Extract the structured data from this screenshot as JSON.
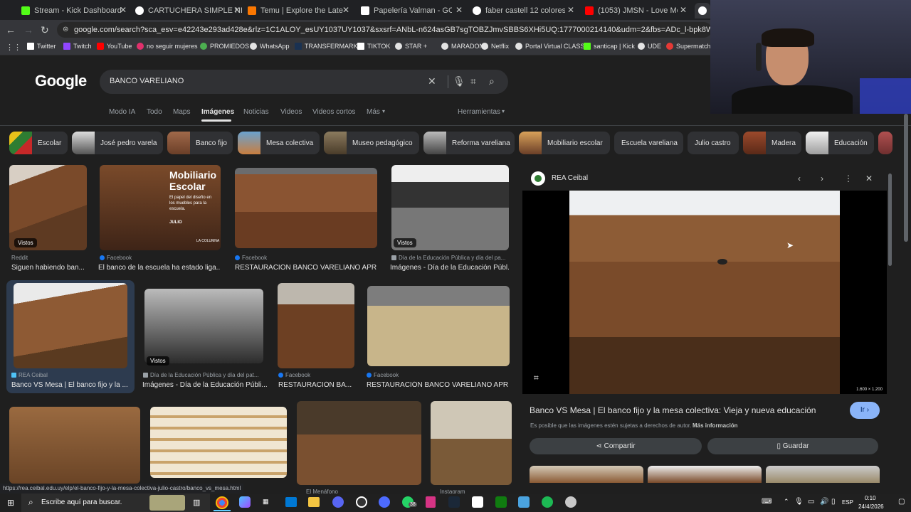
{
  "tabs": [
    {
      "label": "Stream - Kick Dashboard",
      "color": "#53fc18"
    },
    {
      "label": "CARTUCHERA SIMPLE NEGRA",
      "color": "#ffffff"
    },
    {
      "label": "Temu | Explore the Latest Cloth",
      "color": "#fb7701"
    },
    {
      "label": "Papelería Valman - GOMA DE",
      "color": "#ffffff"
    },
    {
      "label": "faber castell 12 colores - Busca",
      "color": "#ffffff"
    },
    {
      "label": "(1053) JMSN - Love Me (Officia",
      "color": "#ff0000"
    }
  ],
  "url": "google.com/search?sca_esv=e42243e293ad428e&rlz=1C1ALOY_esUY1037UY1037&sxsrf=ANbL-n624asGB7sgTOBZJmvSBBS6XHi5UQ:1777000214140&udm=2&fbs=ADc_l-bpk8W4E-qsVlOvbGJcDwpnI1DeJY3rv82Mj8c",
  "bookmarks": [
    "Twitter",
    "Twitch",
    "YouTube",
    "no seguir mujeres",
    "PROMIEDOS",
    "WhatsApp",
    "TRANSFERMARKT",
    "TIKTOK",
    "STAR +",
    "MARADONA",
    "Netflix",
    "Portal Virtual CLASS",
    "santicap | Kick",
    "UDE",
    "Supermatch"
  ],
  "logo": "Google",
  "search": {
    "query": "BANCO VARELIANO"
  },
  "nav_tabs": [
    "Modo IA",
    "Todo",
    "Maps",
    "Imágenes",
    "Noticias",
    "Videos",
    "Videos cortos",
    "Más"
  ],
  "tools_label": "Herramientas",
  "chips": [
    "Escolar",
    "José pedro varela",
    "Banco fijo",
    "Mesa colectiva",
    "Museo pedagógico",
    "Reforma vareliana",
    "Mobiliario escolar",
    "Escuela vareliana",
    "Julio castro",
    "Madera",
    "Educación"
  ],
  "results_row1": [
    {
      "source": "Reddit",
      "title": "Siguen habiendo ban...",
      "badge": "Vistos"
    },
    {
      "source": "Facebook",
      "title": "El banco de la escuela ha estado liga...",
      "overlay_title": "Mobiliario Escolar",
      "overlay_sub": "El papel del diseño en los muebles para la escuela.",
      "overlay_date": "JULIO",
      "overlay_brand": "LA COLUMNA"
    },
    {
      "source": "Facebook",
      "title": "RESTAURACIÓN BANCO VARELIANO APR..."
    },
    {
      "source": "Día de la Educación Pública y día del pa...",
      "title": "Imágenes - Día de la Educación Públ...",
      "badge": "Vistos"
    }
  ],
  "results_row2": [
    {
      "source": "REA Ceibal",
      "title": "Banco VS Mesa | El banco fijo y la ..."
    },
    {
      "source": "Día de la Educación Pública y día del pat...",
      "title": "Imágenes - Día de la Educación Públi...",
      "badge": "Vistos"
    },
    {
      "source": "Facebook",
      "title": "RESTAURACIÓN BA..."
    },
    {
      "source": "Facebook",
      "title": "RESTAURACIÓN BANCO VARELIANO APR..."
    }
  ],
  "results_row3": [
    {
      "source": ""
    },
    {
      "source": ""
    },
    {
      "source": "El Menáfono"
    },
    {
      "source": "Instagram"
    }
  ],
  "panel": {
    "site": "REA Ceibal",
    "dimensions": "1.600 × 1.200",
    "title": "Banco VS Mesa | El banco fijo y la mesa colectiva: Vieja y nueva educación",
    "go_label": "Ir",
    "copyright": "Es posible que las imágenes estén sujetas a derechos de autor.",
    "more_info": "Más información",
    "share_label": "Compartir",
    "save_label": "Guardar"
  },
  "status_url": "https://rea.ceibal.edu.uy/elp/el-banco-fijo-y-la-mesa-colectiva-julio-castro/banco_vs_mesa.html",
  "taskbar": {
    "search_placeholder": "Escribe aquí para buscar.",
    "badge": "38",
    "lang": "ESP",
    "time": "0:10",
    "date": "24/4/2026"
  }
}
